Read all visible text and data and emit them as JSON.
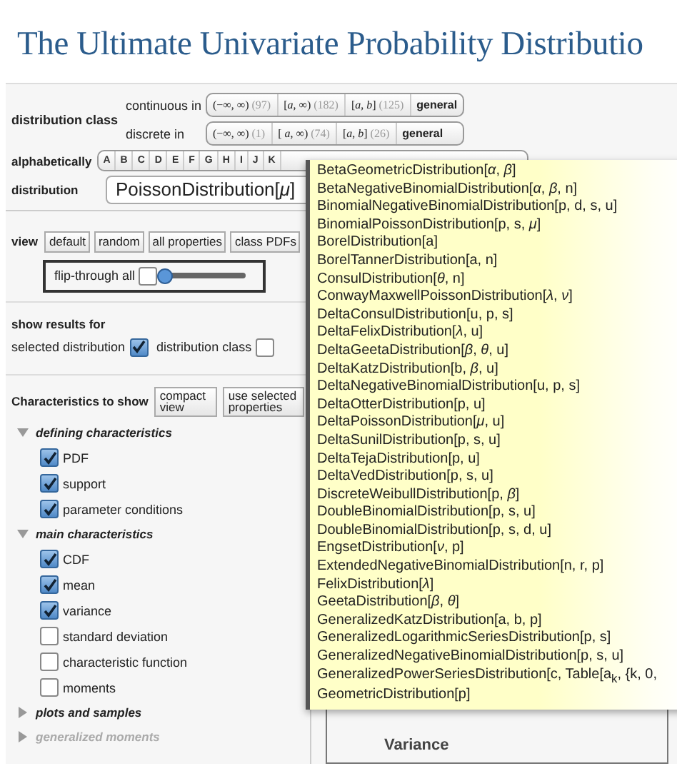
{
  "title": "The Ultimate Univariate Probability Distributio",
  "distribution_class": {
    "label": "distribution class",
    "rows": [
      {
        "label": "continuous in",
        "options": [
          {
            "kind": "range",
            "range": "(−∞, ∞)",
            "count": "(97)"
          },
          {
            "kind": "range",
            "range": "[*a*, ∞)",
            "count": "(182)"
          },
          {
            "kind": "range",
            "range": "[*a*, *b*]",
            "count": "(125)"
          },
          {
            "kind": "general",
            "range": "general"
          }
        ]
      },
      {
        "label": "discrete in",
        "options": [
          {
            "kind": "range",
            "range": "(−∞, ∞)",
            "count": "(1)"
          },
          {
            "kind": "range",
            "range": "[ *a*, ∞)",
            "count": "(74)"
          },
          {
            "kind": "range",
            "range": "[*a*, *b*]",
            "count": "(26)"
          },
          {
            "kind": "general",
            "range": "general"
          }
        ]
      }
    ]
  },
  "alphabet": {
    "label": "alphabetically",
    "letters": [
      "A",
      "B",
      "C",
      "D",
      "E",
      "F",
      "G",
      "H",
      "I",
      "J",
      "K"
    ]
  },
  "distribution": {
    "label": "distribution",
    "value": "PoissonDistribution[*μ*]"
  },
  "view": {
    "label": "view",
    "buttons": [
      "default",
      "random",
      "all properties",
      "class PDFs"
    ]
  },
  "flip_through": {
    "label": "flip-through all",
    "checked": false,
    "level": 0.06
  },
  "show_results": {
    "label": "show results for",
    "options": [
      {
        "label": "selected distribution",
        "checked": true
      },
      {
        "label": "distribution class",
        "checked": false
      }
    ]
  },
  "characteristics": {
    "label": "Characteristics to show",
    "buttons": [
      "compact view",
      "use selected properties"
    ],
    "groups": [
      {
        "label": "defining characteristics",
        "expanded": true,
        "disabled": false,
        "children": [
          {
            "label": "PDF",
            "checked": true
          },
          {
            "label": "support",
            "checked": true
          },
          {
            "label": "parameter conditions",
            "checked": true
          }
        ]
      },
      {
        "label": "main characteristics",
        "expanded": true,
        "disabled": false,
        "children": [
          {
            "label": "CDF",
            "checked": true
          },
          {
            "label": "mean",
            "checked": true
          },
          {
            "label": "variance",
            "checked": true
          },
          {
            "label": "standard deviation",
            "checked": false
          },
          {
            "label": "characteristic function",
            "checked": false
          },
          {
            "label": "moments",
            "checked": false
          }
        ]
      },
      {
        "label": "plots and samples",
        "expanded": false,
        "disabled": false
      },
      {
        "label": "generalized moments",
        "expanded": false,
        "disabled": true
      }
    ]
  },
  "output": {
    "heading": "Variance"
  },
  "popup": {
    "items": [
      "BetaGeometricDistribution[*α*, *β*]",
      "BetaNegativeBinomialDistribution[*α*, *β*, n]",
      "BinomialNegativeBinomialDistribution[p, d, s, u]",
      "BinomialPoissonDistribution[p, s, *μ*]",
      "BorelDistribution[a]",
      "BorelTannerDistribution[a, n]",
      "ConsulDistribution[*θ*, n]",
      "ConwayMaxwellPoissonDistribution[*λ*, *ν*]",
      "DeltaConsulDistribution[u, p, s]",
      "DeltaFelixDistribution[*λ*, u]",
      "DeltaGeetaDistribution[*β*, *θ*, u]",
      "DeltaKatzDistribution[b, *β*, u]",
      "DeltaNegativeBinomialDistribution[u, p, s]",
      "DeltaOtterDistribution[p, u]",
      "DeltaPoissonDistribution[*μ*, u]",
      "DeltaSunilDistribution[p, s, u]",
      "DeltaTejaDistribution[p, u]",
      "DeltaVedDistribution[p, s, u]",
      "DiscreteWeibullDistribution[p, *β*]",
      "DoubleBinomialDistribution[p, s, u]",
      "DoubleBinomialDistribution[p, s, d, u]",
      "EngsetDistribution[*ν*, p]",
      "ExtendedNegativeBinomialDistribution[n, r, p]",
      "FelixDistribution[*λ*]",
      "GeetaDistribution[*β*, *θ*]",
      "GeneralizedKatzDistribution[a, b, p]",
      "GeneralizedLogarithmicSeriesDistribution[p, s]",
      "GeneralizedNegativeBinomialDistribution[p, s, u]",
      "GeneralizedPowerSeriesDistribution[c, Table[a$_{k}$, {k, 0,",
      "GeometricDistribution[p]"
    ]
  }
}
